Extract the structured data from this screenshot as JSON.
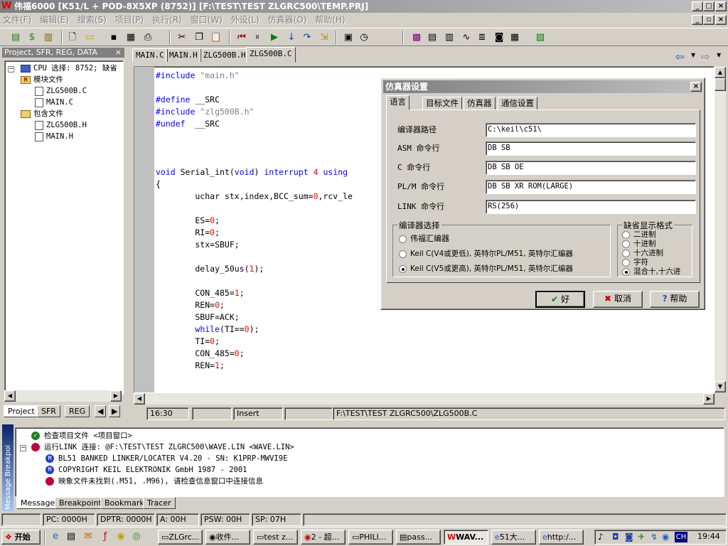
{
  "window": {
    "title": "伟福6000 [K51/L  + POD-8X5XP (8752)] [F:\\TEST\\TEST ZLGRC500\\TEMP.PRJ]",
    "logo": "W"
  },
  "menu": [
    "文件(F)",
    "编辑(E)",
    "搜索(S)",
    "项目(P)",
    "执行(R)",
    "窗口(W)",
    "外设(L)",
    "仿真器(O)",
    "帮助(H)"
  ],
  "left_pane": {
    "title": "Project, SFR, REG, DATA",
    "tree": {
      "cpu": "CPU 选择: 8752; 缺省",
      "module_folder": "模块文件",
      "module_files": [
        "ZLG500B.C",
        "MAIN.C"
      ],
      "include_folder": "包含文件",
      "include_files": [
        "ZLG500B.H",
        "MAIN.H"
      ]
    },
    "tabs": [
      "Project",
      "SFR",
      "REG"
    ]
  },
  "doc_tabs": [
    "MAIN.C",
    "MAIN.H",
    "ZLG500B.H",
    "ZLG500B.C"
  ],
  "code": {
    "l1": {
      "kw": "#include",
      "rest": " \"main.h\""
    },
    "l2": {
      "kw": "#define",
      "rest": " __SRC"
    },
    "l3": {
      "kw": "#include",
      "rest": " \"zlg500B.h\""
    },
    "l4": {
      "kw": "#undef",
      "rest": "  __SRC"
    },
    "l5": {
      "a": "void",
      "b": " Serial_int(",
      "c": "void",
      "d": ") ",
      "e": "interrupt",
      "f": " ",
      "g": "4",
      "h": " ",
      "i": "using"
    },
    "l6": "{",
    "l7": {
      "a": "        uchar stx,index,BCC_sum=",
      "b": "0",
      "c": ",rcv_le"
    },
    "l8": {
      "a": "        ES=",
      "b": "0",
      "c": ";"
    },
    "l9": {
      "a": "        RI=",
      "b": "0",
      "c": ";"
    },
    "l10": "        stx=SBUF;",
    "l11": {
      "a": "        delay_50us(",
      "b": "1",
      "c": ");"
    },
    "l12": {
      "a": "        CON_485=",
      "b": "1",
      "c": ";"
    },
    "l13": {
      "a": "        REN=",
      "b": "0",
      "c": ";"
    },
    "l14": "        SBUF=ACK;",
    "l15": {
      "a": "        ",
      "b": "while",
      "c": "(TI==",
      "d": "0",
      "e": ");"
    },
    "l16": {
      "a": "        TI=",
      "b": "0",
      "c": ";"
    },
    "l17": {
      "a": "        CON_485=",
      "b": "0",
      "c": ";"
    },
    "l18": {
      "a": "        REN=",
      "b": "1",
      "c": ";"
    }
  },
  "editor_status": {
    "pos": "16:30",
    "mode": "Insert",
    "path": "F:\\TEST\\TEST ZLGRC500\\ZLG500B.C"
  },
  "dialog": {
    "title": "仿真器设置",
    "tabs": [
      "语言",
      "目标文件",
      "仿真器",
      "通信设置"
    ],
    "fields": [
      {
        "label": "编译器路径",
        "value": "C:\\keil\\c51\\"
      },
      {
        "label": "ASM 命令行",
        "value": "DB SB"
      },
      {
        "label": "C 命令行",
        "value": "DB SB OE"
      },
      {
        "label": "PL/M 命令行",
        "value": "DB SB XR ROM(LARGE)"
      },
      {
        "label": "LINK 命令行",
        "value": "RS(256)"
      }
    ],
    "compiler_group": "编译器选择",
    "compilers": [
      "伟福汇编器",
      "Keil C(V4或更低), 英特尔PL/M51, 英特尔汇编器",
      "Keil C(V5或更高), 英特尔PL/M51, 英特尔汇编器"
    ],
    "format_group": "缺省显示格式",
    "formats": [
      "二进制",
      "十进制",
      "十六进制",
      "字符",
      "混合十,十六进"
    ],
    "ok": "好",
    "cancel": "取消",
    "help": "帮助"
  },
  "messages": {
    "side_title": "Message Breakpoi",
    "rows": [
      "检查项目文件  <项目窗口>",
      "运行LINK 连接: @F:\\TEST\\TEST ZLGRC500\\WAVE.LIN  <WAVE.LIN>",
      "BL51 BANKED LINKER/LOCATER V4.20 - SN: K1PRP-MWVI9E",
      "COPYRIGHT KEIL ELEKTRONIK GmbH 1987 - 2001",
      "映象文件未找到(.M51, .M96), 请检查信息窗口中连接信息"
    ],
    "tabs": [
      "Message",
      "Breakpoint",
      "Bookmark",
      "Tracer"
    ]
  },
  "cpu_status": {
    "pc": "PC: 0000H",
    "dptr": "DPTR: 0000H",
    "a": "A: 00H",
    "psw": "PSW: 00H",
    "sp": "SP: 07H"
  },
  "taskbar": {
    "start": "开始",
    "tasks": [
      "ZLGrc...",
      "收件...",
      "test z...",
      "2 - 超...",
      "PHILI...",
      "pass...",
      "WAV...",
      "51大...",
      "http:/..."
    ],
    "clock": "19:44",
    "ime": "CH"
  },
  "colors": {
    "keyword": "#0000ff",
    "number": "#ff0000",
    "string": "#808080"
  }
}
